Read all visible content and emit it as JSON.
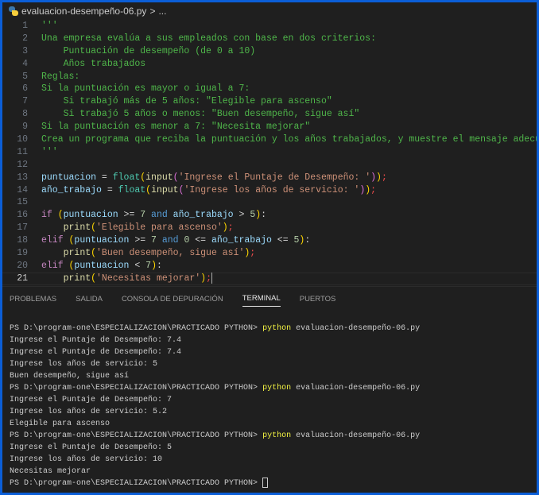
{
  "breadcrumb": {
    "file": "evaluacion-desempeño-06.py",
    "separator": ">",
    "more": "..."
  },
  "editor": {
    "current_line": 21,
    "lines": [
      [
        [
          "'''",
          "doc"
        ]
      ],
      [
        [
          "Una empresa evalúa a sus empleados con base en dos criterios:",
          "doc"
        ]
      ],
      [
        [
          "    Puntuación de desempeño (de 0 a 10)",
          "doc"
        ]
      ],
      [
        [
          "    Años trabajados",
          "doc"
        ]
      ],
      [
        [
          "Reglas:",
          "doc"
        ]
      ],
      [
        [
          "Si la puntuación es mayor o igual a 7:",
          "doc"
        ]
      ],
      [
        [
          "    Si trabajó más de 5 años: \"Elegible para ascenso\"",
          "doc"
        ]
      ],
      [
        [
          "    Si trabajó 5 años o menos: \"Buen desempeño, sigue así\"",
          "doc"
        ]
      ],
      [
        [
          "Si la puntuación es menor a 7: \"Necesita mejorar\"",
          "doc"
        ]
      ],
      [
        [
          "Crea un programa que reciba la puntuación y los años trabajados, y muestre el mensaje adecuado.",
          "doc"
        ]
      ],
      [
        [
          "'''",
          "doc"
        ]
      ],
      [],
      [
        [
          "puntuacion",
          "var"
        ],
        [
          " = ",
          "op"
        ],
        [
          "float",
          "cls"
        ],
        [
          "(",
          "b1"
        ],
        [
          "input",
          "fn"
        ],
        [
          "(",
          "b2"
        ],
        [
          "'Ingrese el Puntaje de Desempeño: '",
          "str"
        ],
        [
          ")",
          "b2"
        ],
        [
          ")",
          "b1"
        ],
        [
          ";",
          "semi"
        ]
      ],
      [
        [
          "año_trabajo",
          "var"
        ],
        [
          " = ",
          "op"
        ],
        [
          "float",
          "cls"
        ],
        [
          "(",
          "b1"
        ],
        [
          "input",
          "fn"
        ],
        [
          "(",
          "b2"
        ],
        [
          "'Ingrese los años de servicio: '",
          "str"
        ],
        [
          ")",
          "b2"
        ],
        [
          ")",
          "b1"
        ],
        [
          ";",
          "semi"
        ]
      ],
      [],
      [
        [
          "if",
          "kw"
        ],
        [
          " ",
          "op"
        ],
        [
          "(",
          "b1"
        ],
        [
          "puntuacion",
          "var"
        ],
        [
          " >= ",
          "op"
        ],
        [
          "7",
          "num"
        ],
        [
          " and ",
          "and"
        ],
        [
          "año_trabajo",
          "var"
        ],
        [
          " > ",
          "op"
        ],
        [
          "5",
          "num"
        ],
        [
          ")",
          "b1"
        ],
        [
          ":",
          "op"
        ]
      ],
      [
        [
          "    ",
          "op"
        ],
        [
          "print",
          "fn"
        ],
        [
          "(",
          "b1"
        ],
        [
          "'Elegible para ascenso'",
          "str"
        ],
        [
          ")",
          "b1"
        ],
        [
          ";",
          "semi"
        ]
      ],
      [
        [
          "elif",
          "kw"
        ],
        [
          " ",
          "op"
        ],
        [
          "(",
          "b1"
        ],
        [
          "puntuacion",
          "var"
        ],
        [
          " >= ",
          "op"
        ],
        [
          "7",
          "num"
        ],
        [
          " and ",
          "and"
        ],
        [
          "0",
          "num"
        ],
        [
          " <= ",
          "op"
        ],
        [
          "año_trabajo",
          "var"
        ],
        [
          " <= ",
          "op"
        ],
        [
          "5",
          "num"
        ],
        [
          ")",
          "b1"
        ],
        [
          ":",
          "op"
        ]
      ],
      [
        [
          "    ",
          "op"
        ],
        [
          "print",
          "fn"
        ],
        [
          "(",
          "b1"
        ],
        [
          "'Buen desempeño, sigue así'",
          "str"
        ],
        [
          ")",
          "b1"
        ],
        [
          ";",
          "semi"
        ]
      ],
      [
        [
          "elif",
          "kw"
        ],
        [
          " ",
          "op"
        ],
        [
          "(",
          "b1"
        ],
        [
          "puntuacion",
          "var"
        ],
        [
          " < ",
          "op"
        ],
        [
          "7",
          "num"
        ],
        [
          ")",
          "b1"
        ],
        [
          ":",
          "op"
        ]
      ],
      [
        [
          "    ",
          "op"
        ],
        [
          "print",
          "fn"
        ],
        [
          "(",
          "b1"
        ],
        [
          "'Necesitas mejorar'",
          "str"
        ],
        [
          ")",
          "b1"
        ],
        [
          ";",
          "semi"
        ]
      ]
    ]
  },
  "panel": {
    "tabs": [
      "PROBLEMAS",
      "SALIDA",
      "CONSOLA DE DEPURACIÓN",
      "TERMINAL",
      "PUERTOS"
    ],
    "active_tab": "TERMINAL"
  },
  "terminal": {
    "lines": [
      {
        "prompt": "PS D:\\program-one\\ESPECIALIZACION\\PRACTICADO PYTHON> ",
        "cmd": "python",
        "args": " evaluacion-desempeño-06.py"
      },
      {
        "text": "Ingrese el Puntaje de Desempeño: 7.4"
      },
      {
        "text": "Ingrese el Puntaje de Desempeño: 7.4"
      },
      {
        "text": "Ingrese los años de servicio: 5"
      },
      {
        "text": "Buen desempeño, sigue así"
      },
      {
        "prompt": "PS D:\\program-one\\ESPECIALIZACION\\PRACTICADO PYTHON> ",
        "cmd": "python",
        "args": " evaluacion-desempeño-06.py"
      },
      {
        "text": "Ingrese el Puntaje de Desempeño: 7"
      },
      {
        "text": "Ingrese los años de servicio: 5.2"
      },
      {
        "text": "Elegible para ascenso"
      },
      {
        "prompt": "PS D:\\program-one\\ESPECIALIZACION\\PRACTICADO PYTHON> ",
        "cmd": "python",
        "args": " evaluacion-desempeño-06.py"
      },
      {
        "text": "Ingrese el Puntaje de Desempeño: 5"
      },
      {
        "text": "Ingrese los años de servicio: 10"
      },
      {
        "text": "Necesitas mejorar"
      },
      {
        "prompt": "PS D:\\program-one\\ESPECIALIZACION\\PRACTICADO PYTHON> ",
        "cursor": true
      }
    ]
  }
}
